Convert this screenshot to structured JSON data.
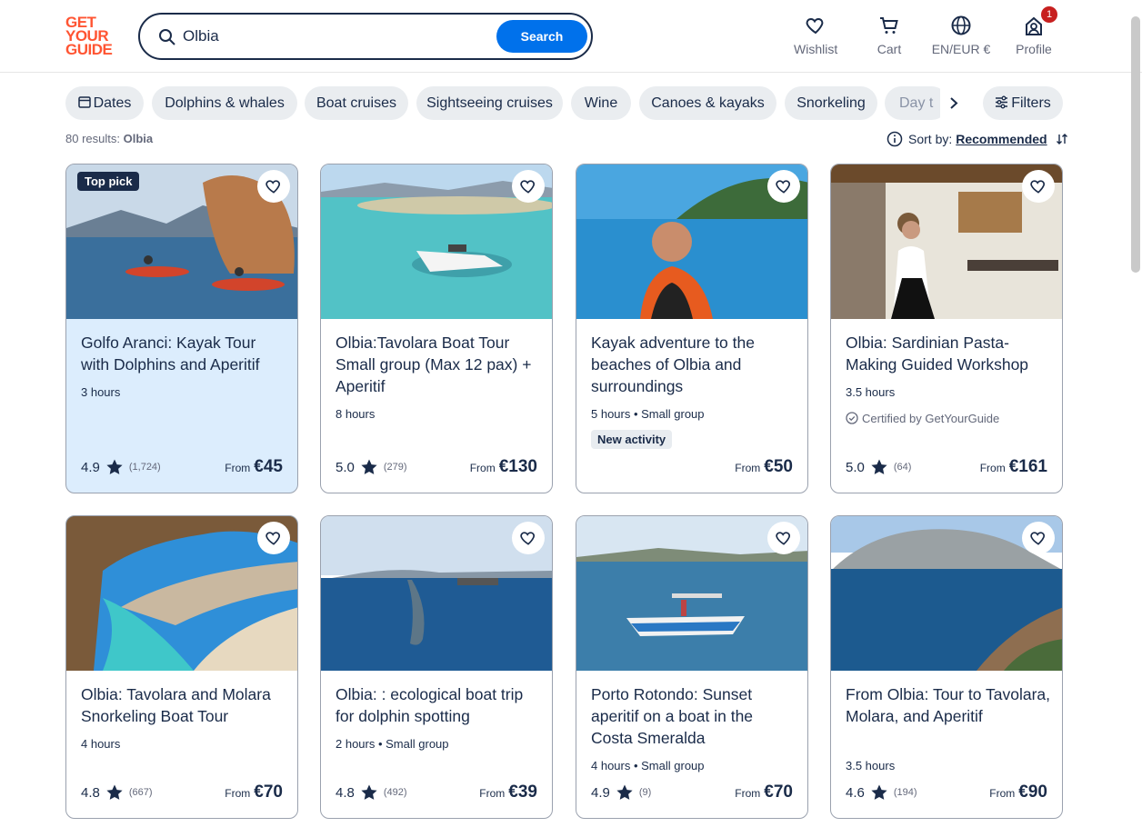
{
  "logo": {
    "line1": "GET",
    "line2": "YOUR",
    "line3": "GUIDE"
  },
  "search": {
    "query": "Olbia",
    "button": "Search"
  },
  "nav": {
    "wishlist": "Wishlist",
    "cart": "Cart",
    "lang": "EN/EUR €",
    "profile": "Profile",
    "profile_badge": "1"
  },
  "chips": [
    "Dates",
    "Dolphins & whales",
    "Boat cruises",
    "Sightseeing cruises",
    "Wine",
    "Canoes & kayaks",
    "Snorkeling",
    "Day t"
  ],
  "filters": "Filters",
  "results": {
    "count": "80 results:",
    "place": "Olbia"
  },
  "sort": {
    "label": "Sort by:",
    "value": "Recommended"
  },
  "cards": [
    {
      "title": "Golfo Aranci: Kayak Tour with Dolphins and Aperitif",
      "meta": "3 hours",
      "rating": "4.9",
      "count": "(1,724)",
      "from": "From",
      "price": "€45",
      "badge": "Top pick"
    },
    {
      "title": "Olbia:Tavolara Boat Tour Small group (Max 12 pax) + Aperitif",
      "meta": "8 hours",
      "rating": "5.0",
      "count": "(279)",
      "from": "From",
      "price": "€130"
    },
    {
      "title": "Kayak adventure to the beaches of Olbia and surroundings",
      "meta": "5 hours • Small group",
      "rating": "",
      "count": "",
      "from": "From",
      "price": "€50",
      "new": "New activity"
    },
    {
      "title": "Olbia: Sardinian Pasta-Making Guided Workshop",
      "meta": "3.5 hours",
      "rating": "5.0",
      "count": "(64)",
      "from": "From",
      "price": "€161",
      "cert": "Certified by GetYourGuide"
    },
    {
      "title": "Olbia: Tavolara and Molara Snorkeling Boat Tour",
      "meta": "4 hours",
      "rating": "4.8",
      "count": "(667)",
      "from": "From",
      "price": "€70"
    },
    {
      "title": "Olbia: : ecological boat trip for dolphin spotting",
      "meta": "2 hours • Small group",
      "rating": "4.8",
      "count": "(492)",
      "from": "From",
      "price": "€39"
    },
    {
      "title": "Porto Rotondo: Sunset aperitif on a boat in the Costa Smeralda",
      "meta": "4 hours • Small group",
      "rating": "4.9",
      "count": "(9)",
      "from": "From",
      "price": "€70"
    },
    {
      "title": "From Olbia: Tour to Tavolara, Molara, and Aperitif",
      "meta": "3.5 hours",
      "rating": "4.6",
      "count": "(194)",
      "from": "From",
      "price": "€90"
    }
  ]
}
